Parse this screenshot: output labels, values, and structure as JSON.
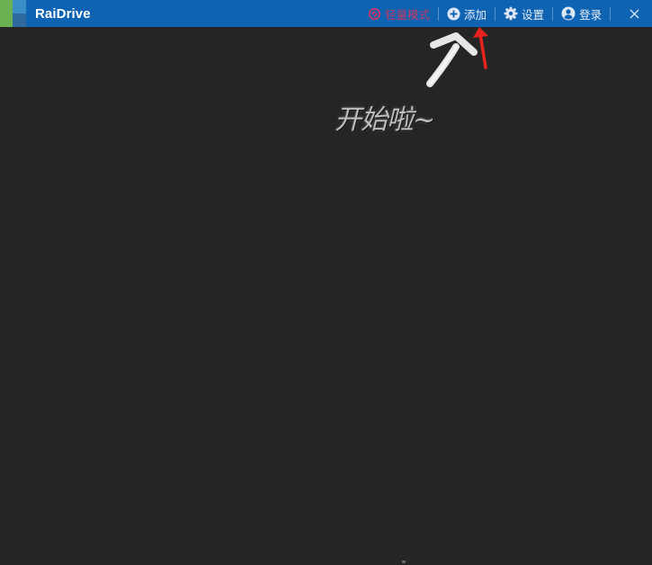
{
  "app": {
    "title": "RaiDrive"
  },
  "toolbar": {
    "premium_label": "轻量模式",
    "add_label": "添加",
    "settings_label": "设置",
    "login_label": "登录"
  },
  "annotation": {
    "text": "开始啦~"
  },
  "colors": {
    "titlebar": "#0e63b2",
    "background": "#252525",
    "premium": "#c23a62",
    "arrow_red": "#e8231e",
    "arrow_white": "#e6e6e6"
  },
  "icons": {
    "premium": "block-icon",
    "add": "plus-circle-icon",
    "settings": "gear-icon",
    "login": "user-circle-icon",
    "close": "close-icon"
  }
}
